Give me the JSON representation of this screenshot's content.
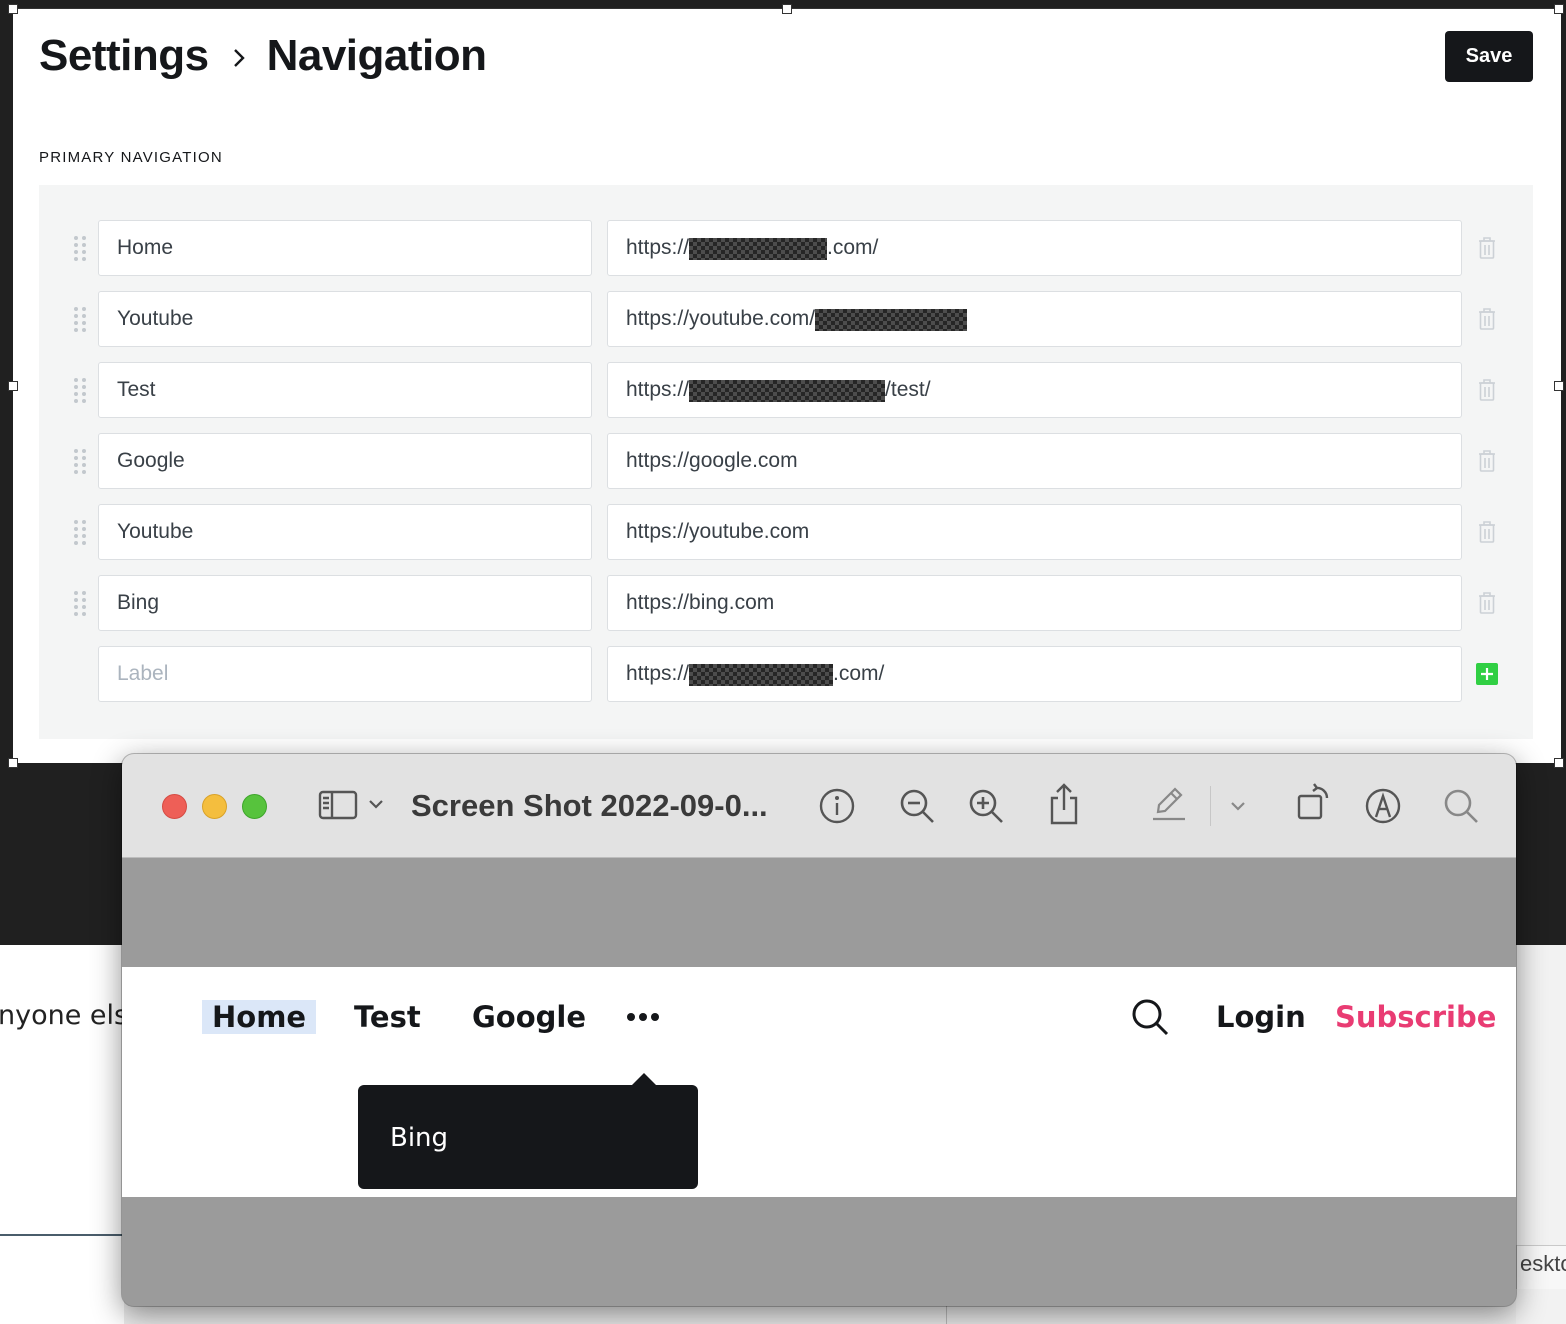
{
  "settings": {
    "breadcrumb": [
      "Settings",
      "Navigation"
    ],
    "save_label": "Save",
    "section_label": "PRIMARY NAVIGATION",
    "items": [
      {
        "label": "Home",
        "url_prefix": "https://",
        "url_suffix": ".com/",
        "redacted": true
      },
      {
        "label": "Youtube",
        "url_prefix": "https://youtube.com/",
        "url_suffix": "",
        "redacted": true
      },
      {
        "label": "Test",
        "url_prefix": "https://",
        "url_suffix": "/test/",
        "redacted": true
      },
      {
        "label": "Google",
        "url_prefix": "https://google.com",
        "url_suffix": "",
        "redacted": false
      },
      {
        "label": "Youtube",
        "url_prefix": "https://youtube.com",
        "url_suffix": "",
        "redacted": false
      },
      {
        "label": "Bing",
        "url_prefix": "https://bing.com",
        "url_suffix": "",
        "redacted": false
      }
    ],
    "new_item": {
      "label_placeholder": "Label",
      "url_prefix": "https://",
      "url_suffix": ".com/"
    },
    "icons": {
      "drag": "drag-handle-icon",
      "delete": "trash-icon",
      "add": "plus-icon"
    },
    "colors": {
      "add": "#30cf43",
      "save_bg": "#15171a"
    }
  },
  "preview": {
    "window_title": "Screen Shot 2022-09-0...",
    "toolbar_icons": [
      "sidebar-icon",
      "chevron-down-icon",
      "info-icon",
      "zoom-out-icon",
      "zoom-in-icon",
      "share-icon",
      "markup-pen-icon",
      "chevron-down-icon",
      "rotate-icon",
      "annotate-icon",
      "search-icon"
    ],
    "site_nav": {
      "items": [
        "Home",
        "Test",
        "Google"
      ],
      "more": "•••",
      "login": "Login",
      "subscribe": "Subscribe",
      "dropdown_items": [
        "Bing"
      ]
    },
    "colors": {
      "subscribe": "#e93c73",
      "active_highlight": "#dbe7f8"
    }
  },
  "background": {
    "left_fragment": "nyone els",
    "right_fragment": "eskto"
  }
}
